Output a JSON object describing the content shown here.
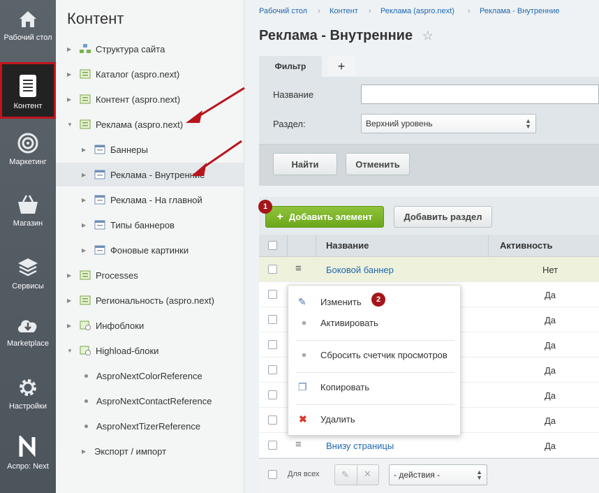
{
  "leftnav": {
    "items": [
      {
        "label": "Рабочий стол",
        "icon": "home-icon"
      },
      {
        "label": "Контент",
        "icon": "document-icon"
      },
      {
        "label": "Маркетинг",
        "icon": "target-icon"
      },
      {
        "label": "Магазин",
        "icon": "basket-icon"
      },
      {
        "label": "Сервисы",
        "icon": "layers-icon"
      },
      {
        "label": "Marketplace",
        "icon": "cloud-download-icon"
      },
      {
        "label": "Настройки",
        "icon": "gear-icon"
      },
      {
        "label": "Аспро: Next",
        "icon": "aspro-logo-icon"
      }
    ],
    "active_color": "#c1141d"
  },
  "tree": {
    "title": "Контент",
    "items": [
      {
        "label": "Структура сайта"
      },
      {
        "label": "Каталог (aspro.next)"
      },
      {
        "label": "Контент (aspro.next)"
      },
      {
        "label": "Реклама (aspro.next)"
      },
      {
        "label": "Баннеры"
      },
      {
        "label": "Реклама - Внутренние"
      },
      {
        "label": "Реклама - На главной"
      },
      {
        "label": "Типы баннеров"
      },
      {
        "label": "Фоновые картинки"
      },
      {
        "label": "Processes"
      },
      {
        "label": "Региональность (aspro.next)"
      },
      {
        "label": "Инфоблоки"
      },
      {
        "label": "Highload-блоки"
      },
      {
        "label": "AsproNextColorReference"
      },
      {
        "label": "AsproNextContactReference"
      },
      {
        "label": "AsproNextTizerReference"
      },
      {
        "label": "Экспорт / импорт"
      }
    ]
  },
  "breadcrumb": [
    "Рабочий стол",
    "Контент",
    "Реклама (aspro.next)",
    "Реклама - Внутренние"
  ],
  "page_title": "Реклама - Внутренние",
  "filter": {
    "tab_label": "Фильтр",
    "add_tab": "+",
    "name_label": "Название",
    "name_value": "",
    "section_label": "Раздел:",
    "section_value": "Верхний уровень",
    "find_button": "Найти",
    "cancel_button": "Отменить"
  },
  "toolbar": {
    "add_element": "Добавить элемент",
    "add_section": "Добавить раздел",
    "step1": "1",
    "step2": "2"
  },
  "grid": {
    "columns": [
      "Название",
      "Активность"
    ],
    "rows": [
      {
        "name": "Боковой баннер",
        "active": "Нет"
      },
      {
        "name": "",
        "active": "Да"
      },
      {
        "name": "",
        "active": "Да"
      },
      {
        "name": "",
        "active": "Да"
      },
      {
        "name": "",
        "active": "Да"
      },
      {
        "name": "",
        "active": "Да"
      },
      {
        "name": "",
        "active": "Да"
      },
      {
        "name": "Внизу страницы",
        "active": "Да"
      }
    ]
  },
  "context_menu": {
    "items": [
      "Изменить",
      "Активировать",
      "Сбросить счетчик просмотров",
      "Копировать",
      "Удалить"
    ]
  },
  "footer": {
    "for_all": "Для всех",
    "actions_value": "- действия -"
  }
}
